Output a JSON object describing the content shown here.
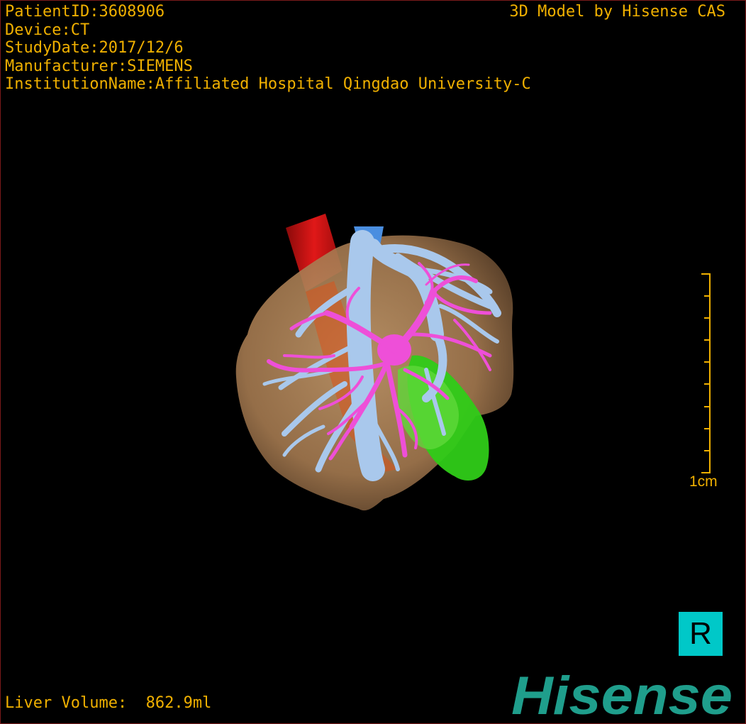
{
  "info": {
    "patient_id": "PatientID:3608906",
    "device": "Device:CT",
    "study_date": "StudyDate:2017/12/6",
    "manufacturer": "Manufacturer:SIEMENS",
    "institution": "InstitutionName:Affiliated Hospital Qingdao University-C"
  },
  "credit": "3D Model by Hisense CAS",
  "scale_label": "1cm",
  "orientation_label": "R",
  "logo_text": "Hisense",
  "liver_volume": "Liver Volume:  862.9ml",
  "colors": {
    "overlay_text": "#f0b000",
    "orientation_box": "#00c8c8",
    "logo": "#1f9e8c",
    "liver": "#b58a5e",
    "portal_vein": "#ee4fd8",
    "hepatic_vein": "#a9c8ec",
    "artery": "#d81212",
    "tumor": "#33cc1a"
  }
}
